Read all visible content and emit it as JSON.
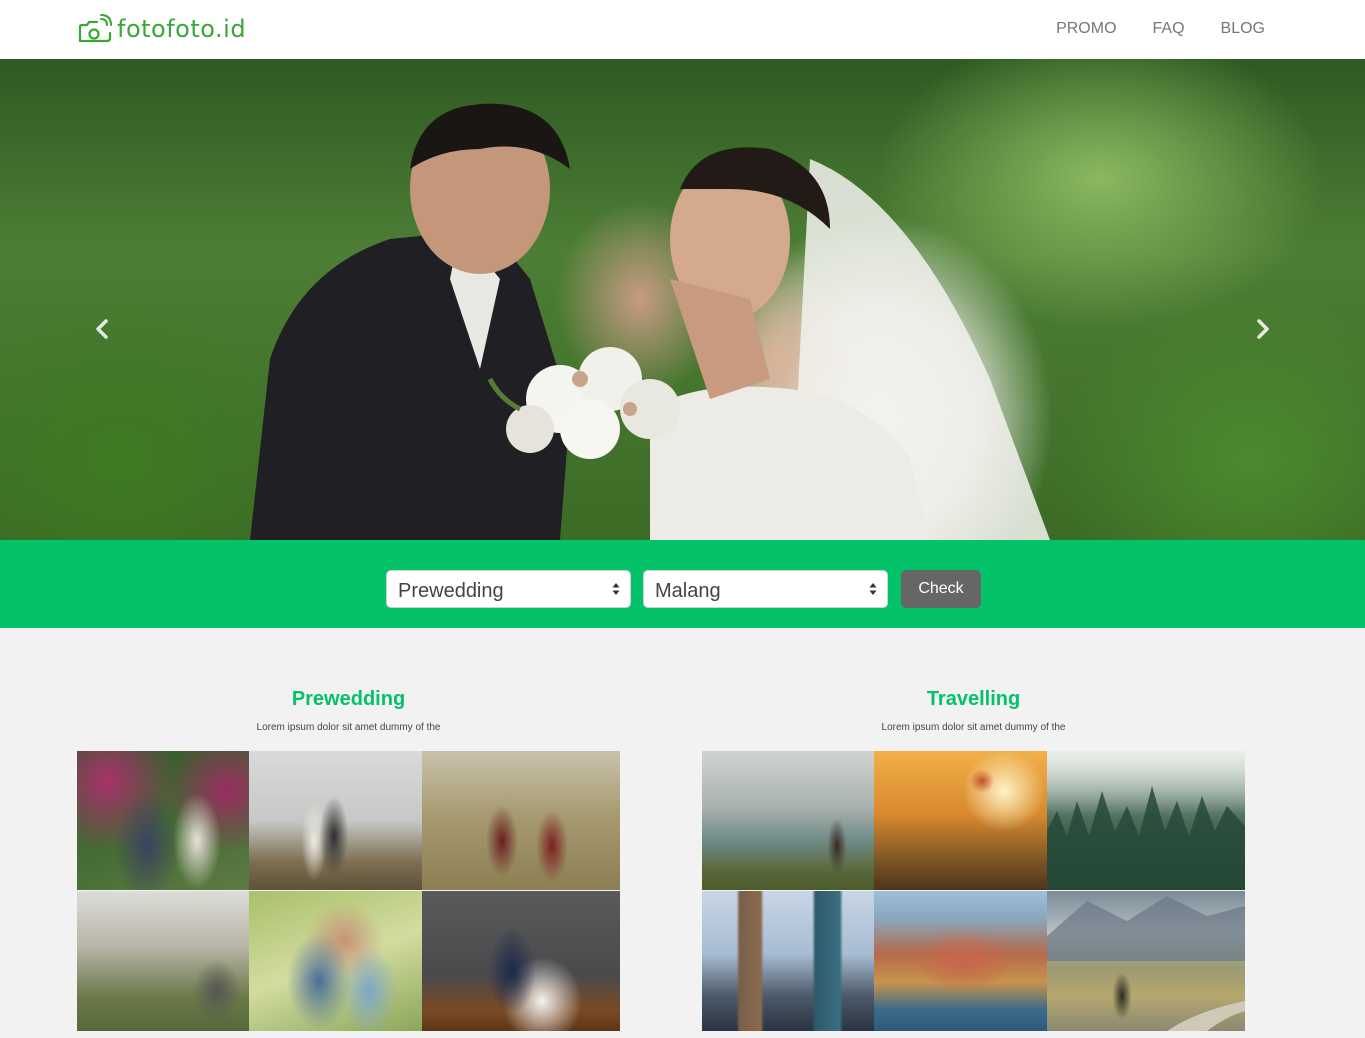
{
  "brand": {
    "name": "fotofoto.id",
    "color": "#3aa635"
  },
  "nav": {
    "items": [
      {
        "label": "PROMO"
      },
      {
        "label": "FAQ"
      },
      {
        "label": "BLOG"
      }
    ]
  },
  "hero": {
    "prev_icon": "chevron-left-icon",
    "next_icon": "chevron-right-icon"
  },
  "search": {
    "category_value": "Prewedding",
    "city_value": "Malang",
    "check_label": "Check",
    "band_color": "#04c26a"
  },
  "sections": {
    "prewedding": {
      "title": "Prewedding",
      "subtitle": "Lorem ipsum dolor sit amet dummy of the"
    },
    "travelling": {
      "title": "Travelling",
      "subtitle": "Lorem ipsum dolor sit amet dummy of the"
    }
  }
}
